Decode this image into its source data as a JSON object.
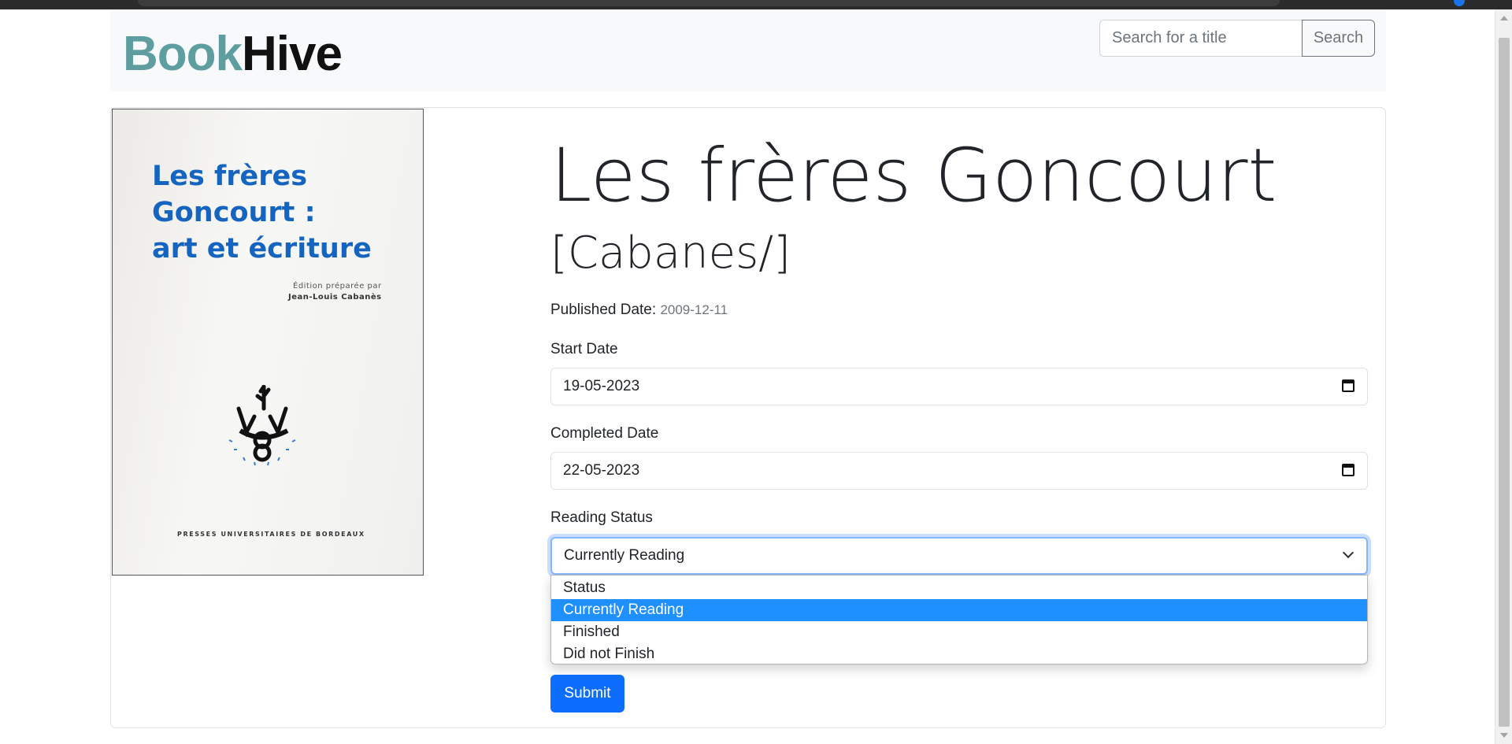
{
  "brand": {
    "part1": "Book",
    "part2": "Hive",
    "accent_color": "#5f9ea0"
  },
  "search": {
    "placeholder": "Search for a title",
    "button_label": "Search"
  },
  "book": {
    "title": "Les frères Goncourt",
    "author": "[Cabanes/]",
    "published_label": "Published Date:",
    "published_date": "2009-12-11",
    "cover": {
      "title_lines": [
        "Les frères",
        "Goncourt :",
        "art et écriture"
      ],
      "edition_line": "Édition préparée par",
      "editor": "Jean-Louis Cabanès",
      "publisher": "PRESSES UNIVERSITAIRES DE BORDEAUX"
    }
  },
  "form": {
    "start_date_label": "Start Date",
    "start_date_value": "19-05-2023",
    "completed_date_label": "Completed Date",
    "completed_date_value": "22-05-2023",
    "status_label": "Reading Status",
    "status_value": "Currently Reading",
    "status_options": [
      "Status",
      "Currently Reading",
      "Finished",
      "Did not Finish"
    ],
    "submit_label": "Submit"
  },
  "icons": {
    "date_picker": "calendar-icon",
    "select_arrow": "chevron-down-icon"
  },
  "colors": {
    "primary": "#0d6efd",
    "selected_option": "#1e90ff"
  }
}
